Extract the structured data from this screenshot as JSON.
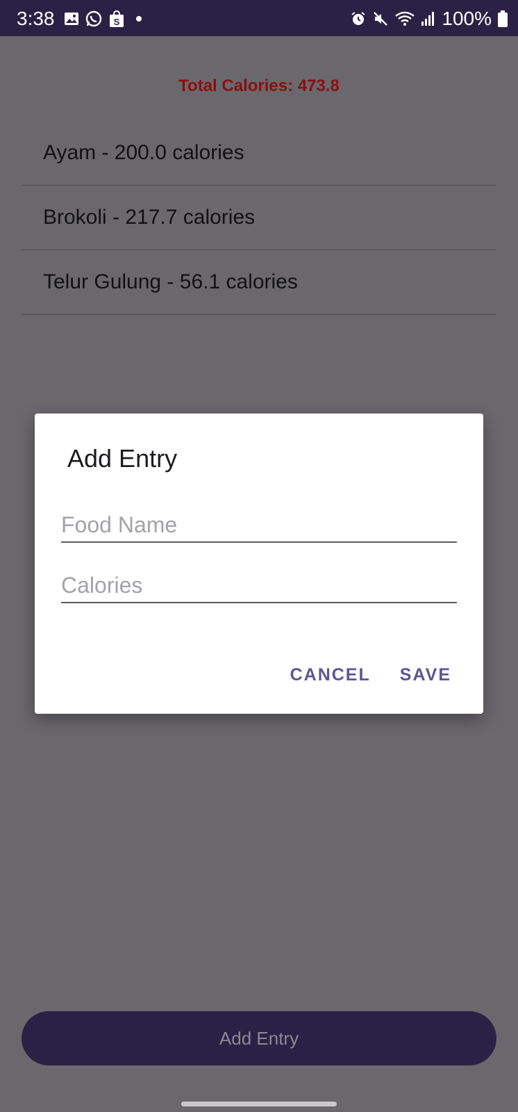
{
  "status_bar": {
    "time": "3:38",
    "left_icons": [
      "gallery-icon",
      "whatsapp-icon",
      "shopee-icon",
      "notification-dot"
    ],
    "right_icons": [
      "alarm-icon",
      "mute-icon",
      "wifi-icon",
      "signal-icon",
      "battery-icon"
    ],
    "battery_text": "100%"
  },
  "summary": {
    "total_label": "Total Calories: 473.8"
  },
  "entries": [
    {
      "label": "Ayam - 200.0 calories"
    },
    {
      "label": "Brokoli - 217.7 calories"
    },
    {
      "label": "Telur Gulung - 56.1 calories"
    }
  ],
  "dialog": {
    "title": "Add Entry",
    "food_name_placeholder": "Food Name",
    "food_name_value": "",
    "calories_placeholder": "Calories",
    "calories_value": "",
    "cancel_label": "CANCEL",
    "save_label": "SAVE"
  },
  "bottom": {
    "add_entry_label": "Add Entry"
  },
  "colors": {
    "accent": "#5e5594",
    "status_bar": "#2b2145",
    "total_text": "#8a0f12",
    "scrim": "#6a686c"
  }
}
